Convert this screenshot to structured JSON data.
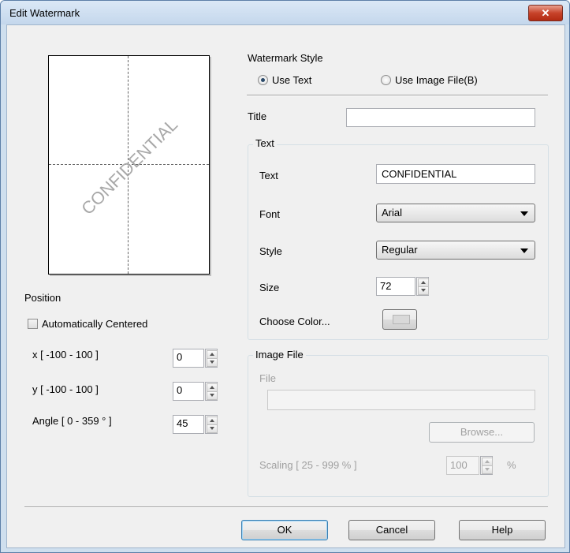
{
  "window": {
    "title": "Edit Watermark",
    "close_glyph": "✕"
  },
  "preview": {
    "watermark_text": "CONFIDENTIAL"
  },
  "position": {
    "heading": "Position",
    "auto_centered_label": "Automatically Centered",
    "auto_centered_checked": false,
    "x_label": "x [ -100  -  100 ]",
    "x_value": "0",
    "y_label": "y [ -100  -  100 ]",
    "y_value": "0",
    "angle_label": "Angle [ 0 - 359 ° ]",
    "angle_value": "45"
  },
  "style": {
    "heading": "Watermark Style",
    "use_text_label": "Use Text",
    "use_image_label": "Use Image File(B)",
    "selected": "text"
  },
  "title_field": {
    "label": "Title",
    "value": ""
  },
  "text_group": {
    "heading": "Text",
    "text_label": "Text",
    "text_value": "CONFIDENTIAL",
    "font_label": "Font",
    "font_value": "Arial",
    "style_label": "Style",
    "style_value": "Regular",
    "size_label": "Size",
    "size_value": "72",
    "color_label": "Choose Color...",
    "color_value": "#d9d9d9"
  },
  "image_group": {
    "heading": "Image File",
    "file_label": "File",
    "file_value": "",
    "browse_label": "Browse...",
    "scaling_label": "Scaling [ 25 - 999 % ]",
    "scaling_value": "100",
    "scaling_unit": "%"
  },
  "buttons": {
    "ok": "OK",
    "cancel": "Cancel",
    "help": "Help"
  }
}
